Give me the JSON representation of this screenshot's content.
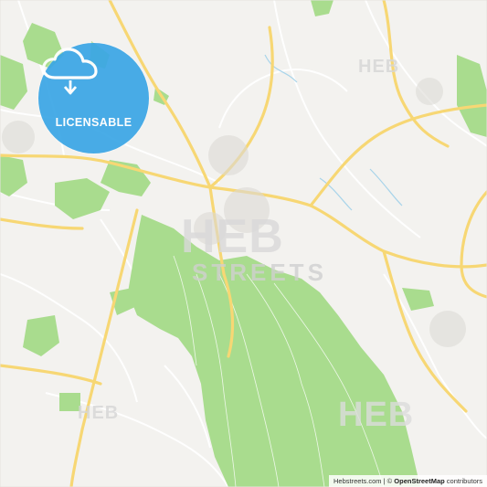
{
  "badge": {
    "label": "LICENSABLE",
    "icon": "cloud-download-icon",
    "color": "#3aa6e6"
  },
  "watermarks": {
    "big": "HEB",
    "streets": "STREETS",
    "small": "HEB"
  },
  "attribution": {
    "site": "Hebstreets.com",
    "separator": " | © ",
    "osm": "OpenStreetMap",
    "suffix": " contributors"
  },
  "colors": {
    "background": "#f3f2ef",
    "park": "#a9dc8e",
    "major_road": "#f7d774",
    "minor_road": "#ffffff",
    "water": "#a8d4ea"
  }
}
